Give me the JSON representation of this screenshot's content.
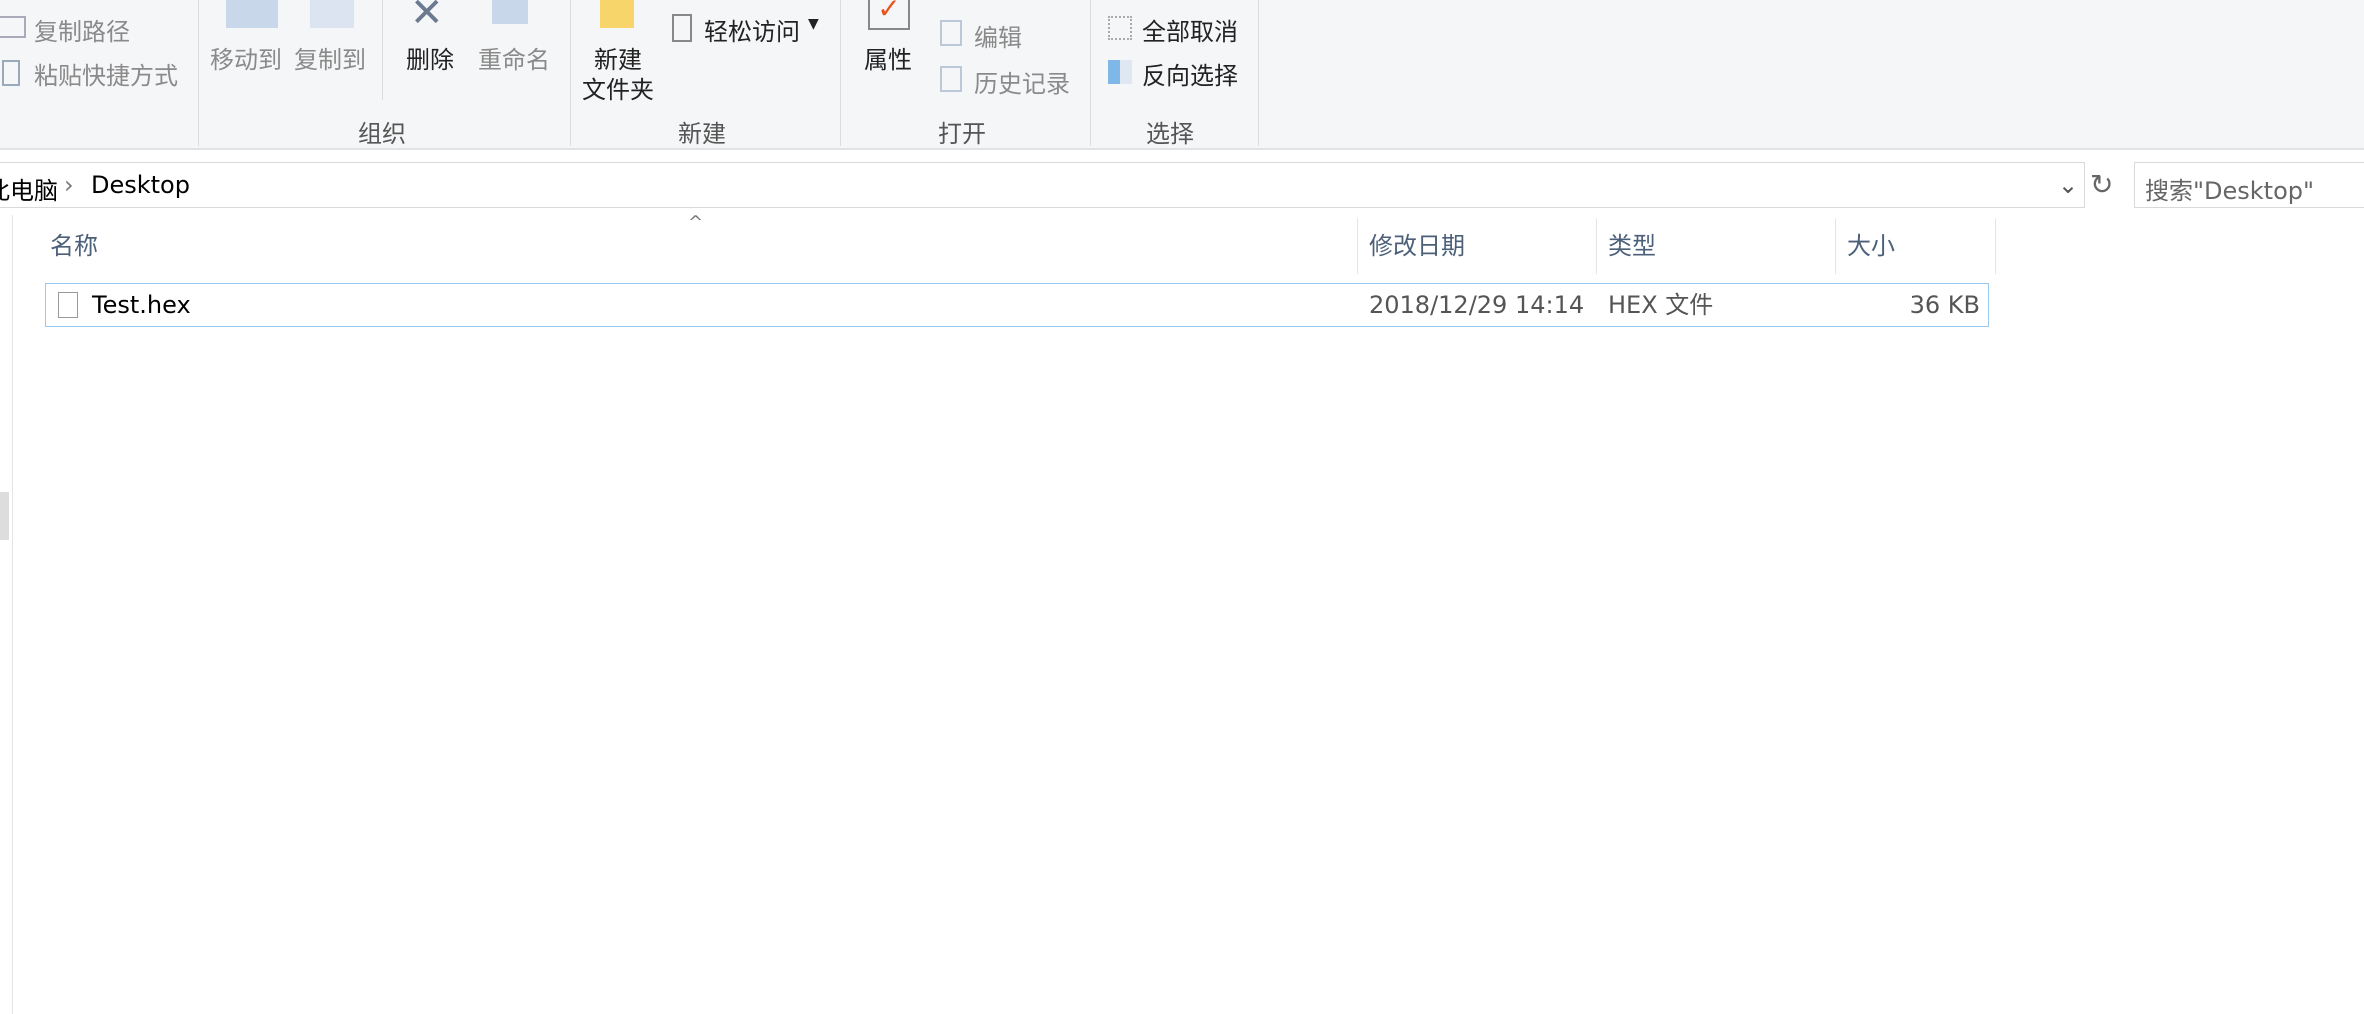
{
  "ribbon": {
    "clipboard": {
      "copy_path": "复制路径",
      "paste_shortcut": "粘贴快捷方式"
    },
    "organize": {
      "move_to": "移动到",
      "copy_to": "复制到",
      "delete": "删除",
      "rename": "重命名",
      "group": "组织"
    },
    "new": {
      "new_folder_line1": "新建",
      "new_folder_line2": "文件夹",
      "easy_access": "轻松访问",
      "group": "新建"
    },
    "open": {
      "properties": "属性",
      "edit": "编辑",
      "history": "历史记录",
      "group": "打开"
    },
    "select": {
      "select_none": "全部取消",
      "invert_selection": "反向选择",
      "group": "选择"
    }
  },
  "address": {
    "crumbs": [
      "此电脑",
      "Desktop"
    ],
    "search_placeholder": "搜索\"Desktop\""
  },
  "columns": {
    "name": "名称",
    "modified": "修改日期",
    "type": "类型",
    "size": "大小"
  },
  "files": [
    {
      "name": "Test.hex",
      "modified": "2018/12/29 14:14",
      "type": "HEX 文件",
      "size": "36 KB"
    }
  ],
  "colors": {
    "accent": "#99c9ef",
    "header_text": "#4c607a",
    "check": "#e8541e"
  }
}
